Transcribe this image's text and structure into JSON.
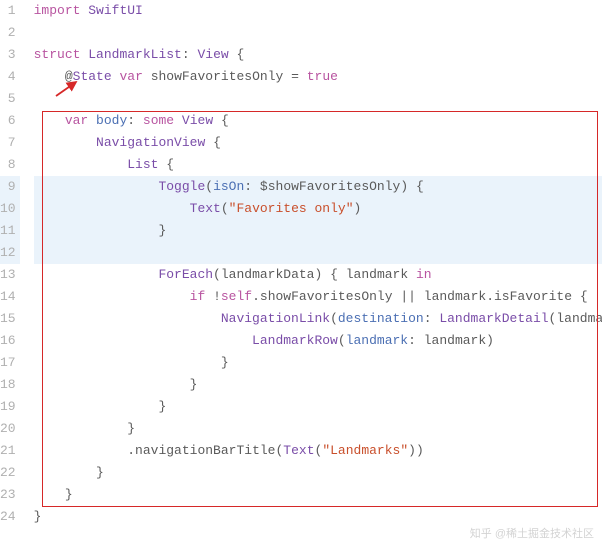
{
  "lines": {
    "count": 24,
    "highlighted": [
      9,
      10,
      11,
      12
    ]
  },
  "code": {
    "l1": {
      "import": "import",
      "module": "SwiftUI"
    },
    "l3": {
      "struct": "struct",
      "name": "LandmarkList",
      "colon": ":",
      "proto": "View",
      "brace": "{"
    },
    "l4": {
      "at": "@",
      "state": "State",
      "var": "var",
      "name": "showFavoritesOnly",
      "eq": "=",
      "val": "true"
    },
    "l6": {
      "var": "var",
      "body": "body",
      "colon": ":",
      "some": "some",
      "view": "View",
      "brace": "{"
    },
    "l7": {
      "nav": "NavigationView",
      "brace": "{"
    },
    "l8": {
      "list": "List",
      "brace": "{"
    },
    "l9": {
      "toggle": "Toggle",
      "lp": "(",
      "isOn": "isOn",
      "colon": ":",
      "dollar": "$",
      "binding": "showFavoritesOnly",
      "rp": ")",
      "brace": "{"
    },
    "l10": {
      "text": "Text",
      "lp": "(",
      "str": "\"Favorites only\"",
      "rp": ")"
    },
    "l11": {
      "close": "}"
    },
    "l13": {
      "foreach": "ForEach",
      "lp": "(",
      "data": "landmarkData",
      "rp": ")",
      "brace": "{",
      "lm": "landmark",
      "in": "in"
    },
    "l14": {
      "if": "if",
      "not": "!",
      "self": "self",
      "dot": ".",
      "prop": "showFavoritesOnly",
      "or": "||",
      "lm": "landmark",
      "dot2": ".",
      "fav": "isFavorite",
      "brace": "{"
    },
    "l15": {
      "navlink": "NavigationLink",
      "lp": "(",
      "dest": "destination",
      "colon": ":",
      "detail": "LandmarkDetail",
      "lp2": "(",
      "lm": "landmark"
    },
    "l16": {
      "row": "LandmarkRow",
      "lp": "(",
      "lm": "landmark",
      "colon": ":",
      "lm2": "landmark",
      "rp": ")"
    },
    "l17": {
      "close": "}"
    },
    "l18": {
      "close": "}"
    },
    "l19": {
      "close": "}"
    },
    "l20": {
      "close": "}"
    },
    "l21": {
      "dot": ".",
      "method": "navigationBarTitle",
      "lp": "(",
      "text": "Text",
      "lp2": "(",
      "str": "\"Landmarks\"",
      "rp2": ")",
      "rp": ")"
    },
    "l22": {
      "close": "}"
    },
    "l23": {
      "close": "}"
    },
    "l24": {
      "close": "}"
    }
  },
  "watermark": "知乎 @稀土掘金技术社区",
  "annotations": {
    "box": {
      "startLine": 6,
      "endLine": 23
    },
    "arrow": {
      "targetLine": 4
    }
  }
}
